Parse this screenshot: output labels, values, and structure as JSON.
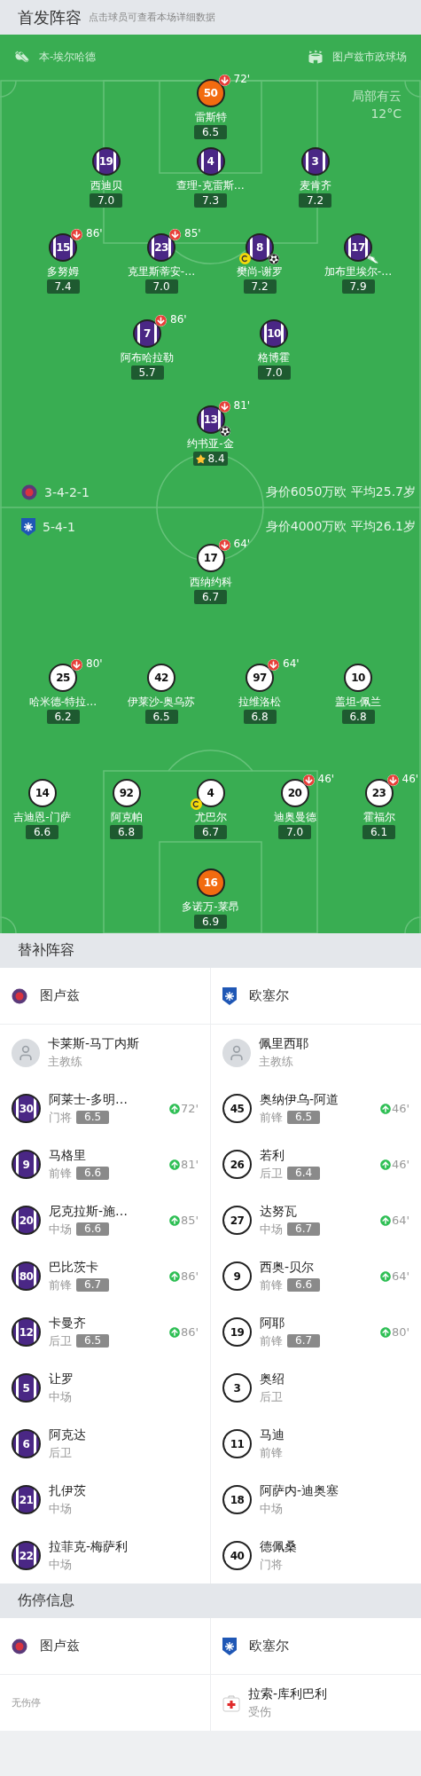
{
  "header": {
    "title": "首发阵容",
    "hint": "点击球员可查看本场详细数据"
  },
  "pitch": {
    "referee": "本-埃尔哈德",
    "stadium": "图卢兹市政球场",
    "weather": {
      "condition": "局部有云",
      "temperature": "12°C"
    },
    "home": {
      "formation": "3-4-2-1",
      "value": "身价6050万欧 平均25.7岁",
      "lines": [
        [
          {
            "number": "50",
            "name": "雷斯特",
            "rating": "6.5",
            "goalkeeper": true,
            "sub_out": "72'",
            "captain": false,
            "goal": false,
            "assist": false,
            "mvp": false
          }
        ],
        [
          {
            "number": "19",
            "name": "西迪贝",
            "rating": "7.0",
            "goalkeeper": false,
            "captain": false,
            "goal": false,
            "assist": false,
            "mvp": false
          },
          {
            "number": "4",
            "name": "查理-克雷斯…",
            "rating": "7.3",
            "goalkeeper": false,
            "captain": false,
            "goal": false,
            "assist": false,
            "mvp": false
          },
          {
            "number": "3",
            "name": "麦肯齐",
            "rating": "7.2",
            "goalkeeper": false,
            "captain": false,
            "goal": false,
            "assist": false,
            "mvp": false
          }
        ],
        [
          {
            "number": "15",
            "name": "多努姆",
            "rating": "7.4",
            "goalkeeper": false,
            "sub_out": "86'",
            "captain": false,
            "goal": false,
            "assist": false,
            "mvp": false
          },
          {
            "number": "23",
            "name": "克里斯蒂安-…",
            "rating": "7.0",
            "goalkeeper": false,
            "sub_out": "85'",
            "captain": false,
            "goal": false,
            "assist": false,
            "mvp": false
          },
          {
            "number": "8",
            "name": "樊尚-谢罗",
            "rating": "7.2",
            "goalkeeper": false,
            "captain": true,
            "goal": true,
            "assist": false,
            "mvp": false
          },
          {
            "number": "17",
            "name": "加布里埃尔-…",
            "rating": "7.9",
            "goalkeeper": false,
            "captain": false,
            "goal": false,
            "assist": true,
            "mvp": false
          }
        ],
        [
          {
            "number": "7",
            "name": "阿布哈拉勒",
            "rating": "5.7",
            "goalkeeper": false,
            "sub_out": "86'",
            "captain": false,
            "goal": false,
            "assist": false,
            "mvp": false
          },
          {
            "number": "10",
            "name": "格博霍",
            "rating": "7.0",
            "goalkeeper": false,
            "captain": false,
            "goal": false,
            "assist": false,
            "mvp": false
          }
        ],
        [
          {
            "number": "13",
            "name": "约书亚-金",
            "rating": "8.4",
            "goalkeeper": false,
            "sub_out": "81'",
            "captain": false,
            "goal": true,
            "assist": false,
            "mvp": true
          }
        ]
      ]
    },
    "away": {
      "formation": "5-4-1",
      "value": "身价4000万欧 平均26.1岁",
      "lines": [
        [
          {
            "number": "17",
            "name": "西纳约科",
            "rating": "6.7",
            "goalkeeper": false,
            "sub_out": "64'",
            "captain": false,
            "goal": false,
            "assist": false,
            "mvp": false
          }
        ],
        [
          {
            "number": "25",
            "name": "哈米德-特拉…",
            "rating": "6.2",
            "goalkeeper": false,
            "sub_out": "80'",
            "captain": false,
            "goal": false,
            "assist": false,
            "mvp": false
          },
          {
            "number": "42",
            "name": "伊莱沙-奥乌苏",
            "rating": "6.5",
            "goalkeeper": false,
            "captain": false,
            "goal": false,
            "assist": false,
            "mvp": false
          },
          {
            "number": "97",
            "name": "拉维洛松",
            "rating": "6.8",
            "goalkeeper": false,
            "sub_out": "64'",
            "captain": false,
            "goal": false,
            "assist": false,
            "mvp": false
          },
          {
            "number": "10",
            "name": "盖坦-佩兰",
            "rating": "6.8",
            "goalkeeper": false,
            "captain": false,
            "goal": false,
            "assist": false,
            "mvp": false
          }
        ],
        [
          {
            "number": "14",
            "name": "吉迪恩-门萨",
            "rating": "6.6",
            "goalkeeper": false,
            "captain": false,
            "goal": false,
            "assist": false,
            "mvp": false
          },
          {
            "number": "92",
            "name": "阿克帕",
            "rating": "6.8",
            "goalkeeper": false,
            "captain": false,
            "goal": false,
            "assist": false,
            "mvp": false
          },
          {
            "number": "4",
            "name": "尤巴尔",
            "rating": "6.7",
            "goalkeeper": false,
            "captain": true,
            "goal": false,
            "assist": false,
            "mvp": false
          },
          {
            "number": "20",
            "name": "迪奥曼德",
            "rating": "7.0",
            "goalkeeper": false,
            "sub_out": "46'",
            "captain": false,
            "goal": false,
            "assist": false,
            "mvp": false
          },
          {
            "number": "23",
            "name": "霍福尔",
            "rating": "6.1",
            "goalkeeper": false,
            "sub_out": "46'",
            "captain": false,
            "goal": false,
            "assist": false,
            "mvp": false
          }
        ],
        [
          {
            "number": "16",
            "name": "多诺万-莱昂",
            "rating": "6.9",
            "goalkeeper": true,
            "captain": false,
            "goal": false,
            "assist": false,
            "mvp": false
          }
        ]
      ]
    }
  },
  "substitutes": {
    "title": "替补阵容",
    "teams": [
      {
        "team": "图卢兹",
        "coach": {
          "name": "卡莱斯-马丁内斯",
          "role": "主教练"
        },
        "players": [
          {
            "number": "30",
            "name": "阿莱士-多明…",
            "position": "门将",
            "rating": "6.5",
            "sub_in": "72'"
          },
          {
            "number": "9",
            "name": "马格里",
            "position": "前锋",
            "rating": "6.6",
            "sub_in": "81'"
          },
          {
            "number": "20",
            "name": "尼克拉斯-施…",
            "position": "中场",
            "rating": "6.6",
            "sub_in": "85'"
          },
          {
            "number": "80",
            "name": "巴比茨卡",
            "position": "前锋",
            "rating": "6.7",
            "sub_in": "86'"
          },
          {
            "number": "12",
            "name": "卡曼齐",
            "position": "后卫",
            "rating": "6.5",
            "sub_in": "86'"
          },
          {
            "number": "5",
            "name": "让罗",
            "position": "中场"
          },
          {
            "number": "6",
            "name": "阿克达",
            "position": "后卫"
          },
          {
            "number": "21",
            "name": "扎伊茨",
            "position": "中场"
          },
          {
            "number": "22",
            "name": "拉菲克-梅萨利",
            "position": "中场"
          }
        ]
      },
      {
        "team": "欧塞尔",
        "coach": {
          "name": "佩里西耶",
          "role": "主教练"
        },
        "players": [
          {
            "number": "45",
            "name": "奥纳伊乌-阿道",
            "position": "前锋",
            "rating": "6.5",
            "sub_in": "46'"
          },
          {
            "number": "26",
            "name": "若利",
            "position": "后卫",
            "rating": "6.4",
            "sub_in": "46'"
          },
          {
            "number": "27",
            "name": "达努瓦",
            "position": "中场",
            "rating": "6.7",
            "sub_in": "64'"
          },
          {
            "number": "9",
            "name": "西奥-贝尔",
            "position": "前锋",
            "rating": "6.6",
            "sub_in": "64'"
          },
          {
            "number": "19",
            "name": "阿耶",
            "position": "前锋",
            "rating": "6.7",
            "sub_in": "80'"
          },
          {
            "number": "3",
            "name": "奥绍",
            "position": "后卫"
          },
          {
            "number": "11",
            "name": "马迪",
            "position": "前锋"
          },
          {
            "number": "18",
            "name": "阿萨内-迪奥塞",
            "position": "中场"
          },
          {
            "number": "40",
            "name": "德佩桑",
            "position": "门将"
          }
        ]
      }
    ]
  },
  "injuries": {
    "title": "伤停信息",
    "teams": [
      {
        "team": "图卢兹",
        "note": "无伤停"
      },
      {
        "team": "欧塞尔",
        "players": [
          {
            "name": "拉索-库利巴利",
            "status": "受伤"
          }
        ]
      }
    ]
  }
}
